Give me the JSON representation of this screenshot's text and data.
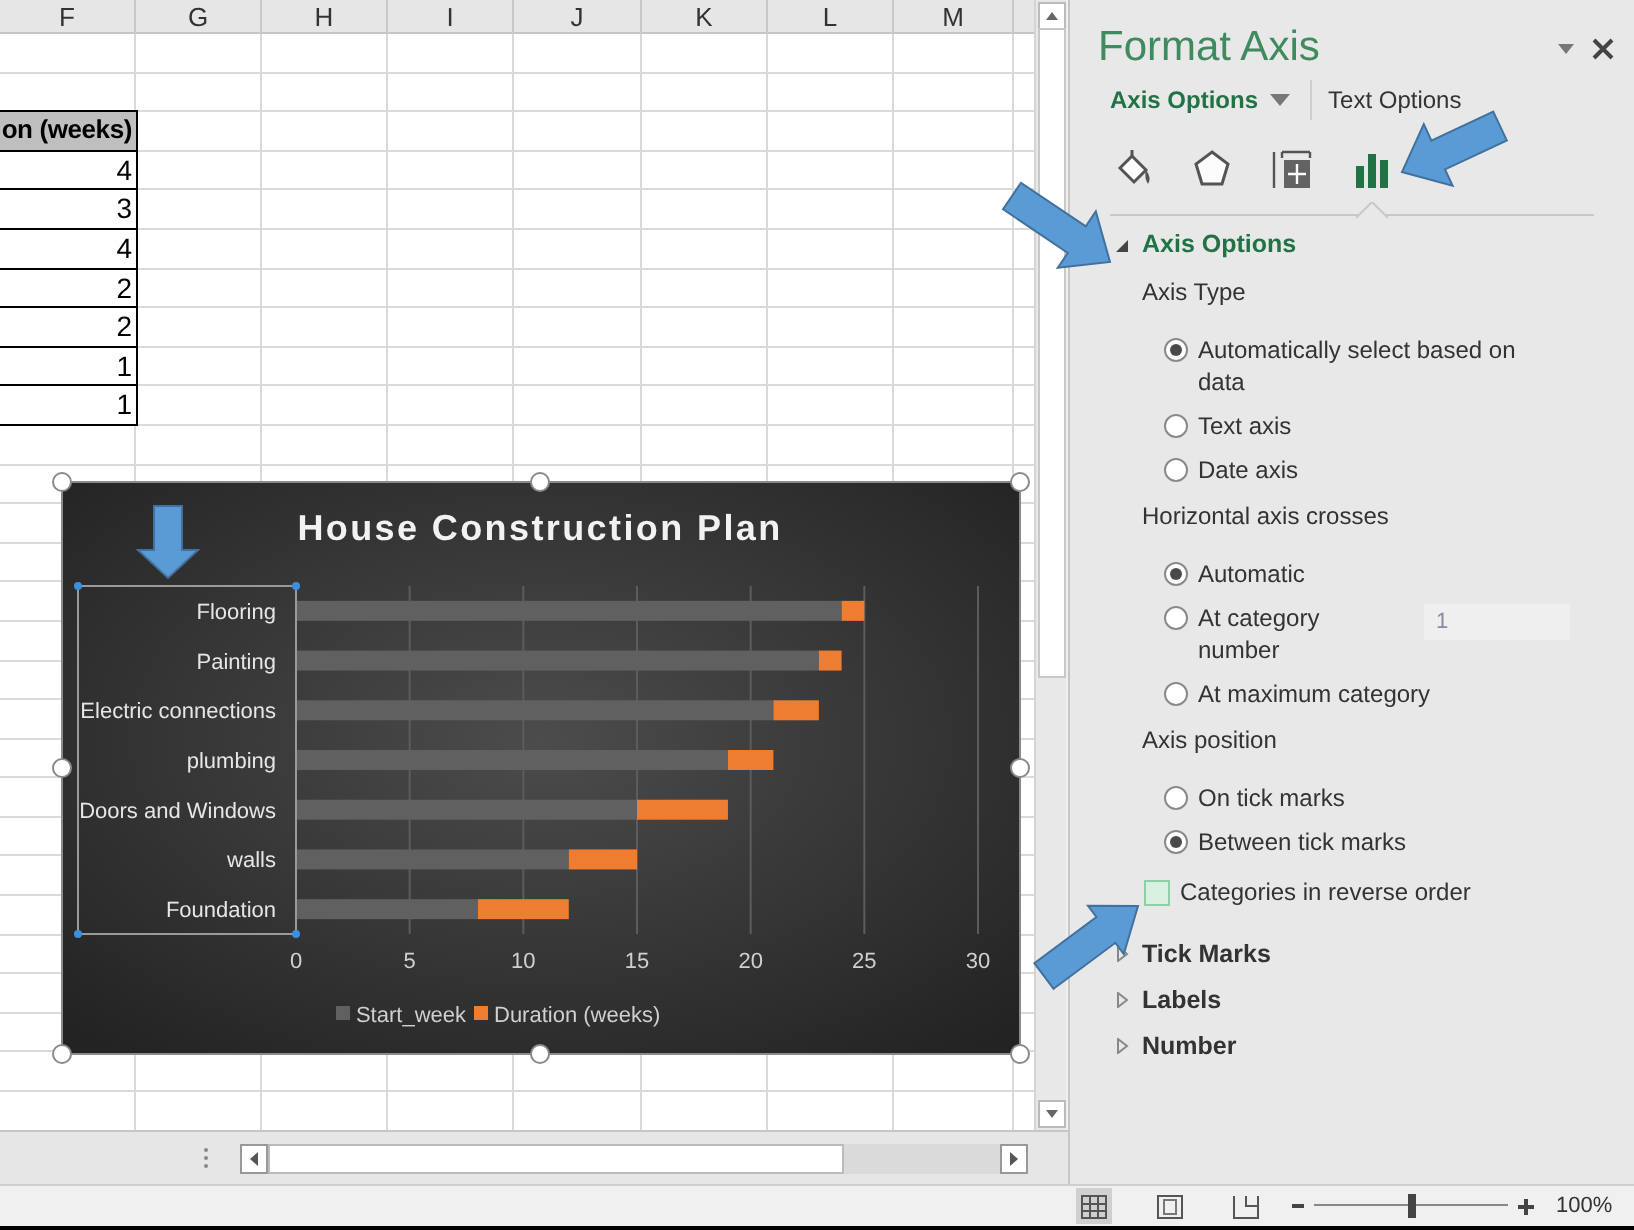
{
  "spreadsheet": {
    "columns": [
      "F",
      "G",
      "H",
      "I",
      "J",
      "K",
      "L",
      "M"
    ],
    "column_f_cells": [
      {
        "kind": "header",
        "text": "on (weeks)"
      },
      {
        "kind": "value",
        "text": "4"
      },
      {
        "kind": "value",
        "text": "3"
      },
      {
        "kind": "value",
        "text": "4"
      },
      {
        "kind": "value",
        "text": "2"
      },
      {
        "kind": "value",
        "text": "2"
      },
      {
        "kind": "value",
        "text": "1"
      },
      {
        "kind": "value",
        "text": "1"
      }
    ]
  },
  "chart": {
    "selected": true,
    "axis_selected": true,
    "chart_data": {
      "type": "bar",
      "orientation": "horizontal",
      "stacked": true,
      "title": "House Construction Plan",
      "categories": [
        "Flooring",
        "Painting",
        "Electric connections",
        "plumbing",
        "Doors and Windows",
        "walls",
        "Foundation"
      ],
      "series": [
        {
          "name": "Start_week",
          "color": "#606060",
          "values": [
            24,
            23,
            21,
            19,
            15,
            12,
            8
          ]
        },
        {
          "name": "Duration (weeks)",
          "color": "#ed7d31",
          "values": [
            1,
            1,
            2,
            2,
            4,
            3,
            4
          ]
        }
      ],
      "xlim": [
        0,
        30
      ],
      "xticks": [
        0,
        5,
        10,
        15,
        20,
        25,
        30
      ],
      "grid": true,
      "legend": "bottom"
    }
  },
  "format_pane": {
    "title": "Format Axis",
    "tabs": [
      {
        "label": "Axis Options",
        "selected": true
      },
      {
        "label": "Text Options",
        "selected": false
      }
    ],
    "icons": [
      {
        "kind": "fill",
        "selected": false
      },
      {
        "kind": "effects",
        "selected": false
      },
      {
        "kind": "size",
        "selected": false
      },
      {
        "kind": "axis",
        "selected": true
      }
    ],
    "sections": [
      {
        "label": "Axis Options",
        "expanded": true,
        "items": [
          {
            "kind": "heading",
            "text": "Axis Type"
          },
          {
            "kind": "radio",
            "label": "Automatically select based on data",
            "selected": true
          },
          {
            "kind": "radio",
            "label": "Text axis",
            "selected": false
          },
          {
            "kind": "radio",
            "label": "Date axis",
            "selected": false
          },
          {
            "kind": "heading",
            "text": "Horizontal axis crosses"
          },
          {
            "kind": "radio",
            "label": "Automatic",
            "selected": true
          },
          {
            "kind": "radio",
            "label": "At category number",
            "selected": false,
            "field": {
              "value": "1",
              "disabled": true
            }
          },
          {
            "kind": "radio",
            "label": "At maximum category",
            "selected": false
          },
          {
            "kind": "heading",
            "text": "Axis position"
          },
          {
            "kind": "radio",
            "label": "On tick marks",
            "selected": false
          },
          {
            "kind": "radio",
            "label": "Between tick marks",
            "selected": true
          },
          {
            "kind": "checkbox",
            "label": "Categories in reverse order",
            "checked": false
          }
        ]
      },
      {
        "label": "Tick Marks",
        "expanded": false
      },
      {
        "label": "Labels",
        "expanded": false
      },
      {
        "label": "Number",
        "expanded": false
      }
    ]
  },
  "status_bar": {
    "views": [
      {
        "kind": "normal",
        "selected": true
      },
      {
        "kind": "page_layout",
        "selected": false
      },
      {
        "kind": "page_break",
        "selected": false
      }
    ],
    "zoom": {
      "level": 0.5,
      "reading": "100%"
    }
  }
}
